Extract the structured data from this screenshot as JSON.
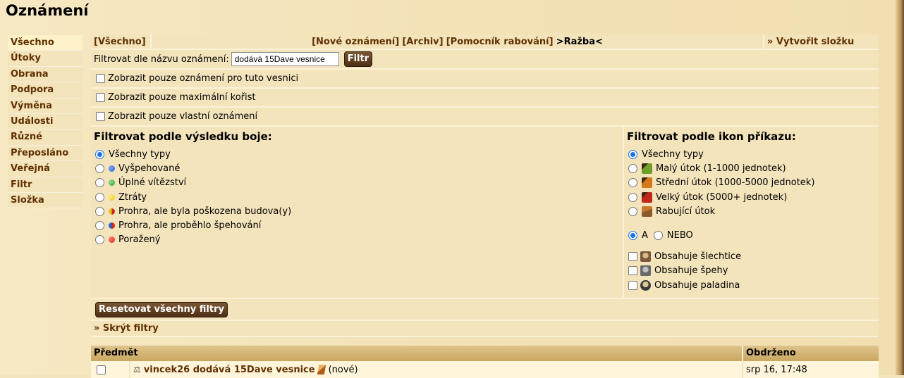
{
  "title": "Oznámení",
  "menu": [
    {
      "label": "Všechno",
      "active": true
    },
    {
      "label": "Útoky"
    },
    {
      "label": "Obrana"
    },
    {
      "label": "Podpora"
    },
    {
      "label": "Výměna"
    },
    {
      "label": "Události"
    },
    {
      "label": "Různé"
    },
    {
      "label": "Přeposláno"
    },
    {
      "label": "Veřejná"
    },
    {
      "label": "Filtr"
    },
    {
      "label": "Složka"
    }
  ],
  "tabs": {
    "all": "[Všechno]",
    "new": "[Nové oznámení]",
    "archive": "[Archiv]",
    "helper": "[Pomocník rabování]",
    "current": ">Ražba<",
    "create_folder": "» Vytvořit složku"
  },
  "filter": {
    "label": "Filtrovat dle názvu oznámení:",
    "value": "dodává 15Dave vesnice",
    "button": "Filtr"
  },
  "checks": [
    "Zobrazit pouze oznámení pro tuto vesnici",
    "Zobrazit pouze maximální kořist",
    "Zobrazit pouze vlastní oznámení"
  ],
  "result_filter": {
    "heading": "Filtrovat podle výsledku boje:",
    "options": [
      {
        "label": "Všechny typy",
        "selected": true
      },
      {
        "label": "Vyšpehované",
        "dot": "#2a5fd0"
      },
      {
        "label": "Úplné vítězství",
        "dot": "#2e9e2e"
      },
      {
        "label": "Ztráty",
        "dot": "#e5c21a"
      },
      {
        "label": "Prohra, ale byla poškozena budova(y)",
        "dot": "half-red-yellow"
      },
      {
        "label": "Prohra, ale proběhlo špehování",
        "dot": "half-red-blue"
      },
      {
        "label": "Poražený",
        "dot": "#d02a1a"
      }
    ]
  },
  "icon_filter": {
    "heading": "Filtrovat podle ikon příkazu:",
    "options": [
      {
        "label": "Všechny typy",
        "selected": true
      },
      {
        "label": "Malý útok (1-1000 jednotek)",
        "icon": "small-attack-icon"
      },
      {
        "label": "Střední útok (1000-5000 jednotek)",
        "icon": "medium-attack-icon"
      },
      {
        "label": "Velký útok (5000+ jednotek)",
        "icon": "large-attack-icon"
      },
      {
        "label": "Rabující útok",
        "icon": "farm-attack-icon"
      }
    ],
    "and_label": "A",
    "or_label": "NEBO",
    "contains": [
      {
        "label": "Obsahuje šlechtice",
        "icon": "noble-icon"
      },
      {
        "label": "Obsahuje špehy",
        "icon": "spy-icon"
      },
      {
        "label": "Obsahuje paladina",
        "icon": "paladin-icon"
      }
    ]
  },
  "reset_button": "Resetovat všechny filtry",
  "hide_filters": "» Skrýt filtry",
  "table": {
    "col_subject": "Předmět",
    "col_received": "Obdrženo",
    "rows": [
      {
        "subject": "vincek26 dodává 15Dave vesnice",
        "status": "(nové)",
        "received": "srp 16, 17:48"
      }
    ]
  }
}
